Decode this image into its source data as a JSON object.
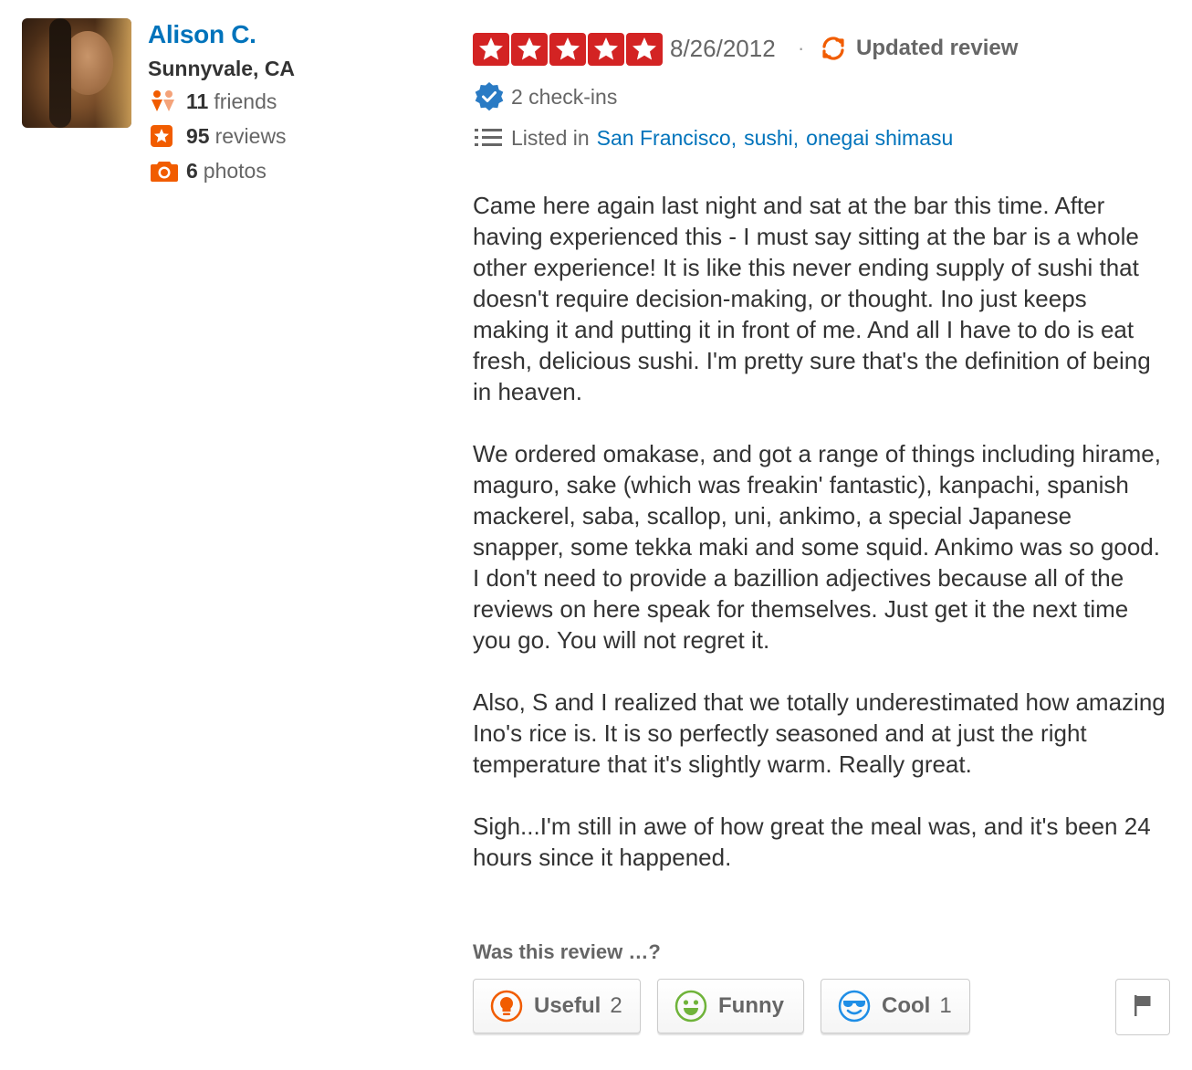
{
  "user": {
    "name": "Alison C.",
    "location": "Sunnyvale, CA",
    "friends_count": "11",
    "friends_label": "friends",
    "reviews_count": "95",
    "reviews_label": "reviews",
    "photos_count": "6",
    "photos_label": "photos"
  },
  "review": {
    "rating": 5,
    "date": "8/26/2012",
    "separator": "·",
    "updated_label": "Updated review",
    "checkins": "2 check-ins",
    "listed_prefix": "Listed in",
    "lists": [
      "San Francisco",
      "sushi",
      "onegai shimasu"
    ],
    "paragraphs": [
      "Came here again last night and sat at the bar this time. After having experienced this - I must say sitting at the bar is a whole other experience! It is like this never ending supply of sushi that doesn't require decision-making, or thought. Ino just keeps making it and putting it in front of me. And all I have to do is eat fresh, delicious sushi. I'm pretty sure that's the definition of being in heaven.",
      "We ordered omakase, and got a range of things including hirame, maguro, sake (which was freakin' fantastic), kanpachi, spanish mackerel, saba, scallop, uni, ankimo, a special Japanese snapper, some tekka maki and some squid. Ankimo was so good. I don't need to provide a bazillion adjectives because all of the reviews on here speak for themselves. Just get it the next time you go. You will not regret it.",
      "Also, S and I realized that we totally underestimated how amazing Ino's rice is. It is so perfectly seasoned and at just the right temperature that it's slightly warm. Really great.",
      "Sigh...I'm still in awe of how great the meal was, and it's been 24 hours since it happened."
    ]
  },
  "feedback": {
    "question": "Was this review …?",
    "useful_label": "Useful",
    "useful_count": "2",
    "funny_label": "Funny",
    "funny_count": "",
    "cool_label": "Cool",
    "cool_count": "1"
  },
  "icons": {
    "friends": "friends-icon",
    "reviews": "star-badge-icon",
    "photos": "camera-icon",
    "updated": "refresh-icon",
    "checkin": "verified-badge-icon",
    "list": "list-icon",
    "useful": "lightbulb-icon",
    "funny": "smiley-icon",
    "cool": "sunglasses-smiley-icon",
    "flag": "flag-icon"
  },
  "colors": {
    "link": "#0073bb",
    "star_red": "#d32323",
    "orange": "#f15c00",
    "text": "#333333",
    "muted": "#666666",
    "funny_green": "#6fb33a",
    "cool_blue": "#1f8ee6"
  }
}
